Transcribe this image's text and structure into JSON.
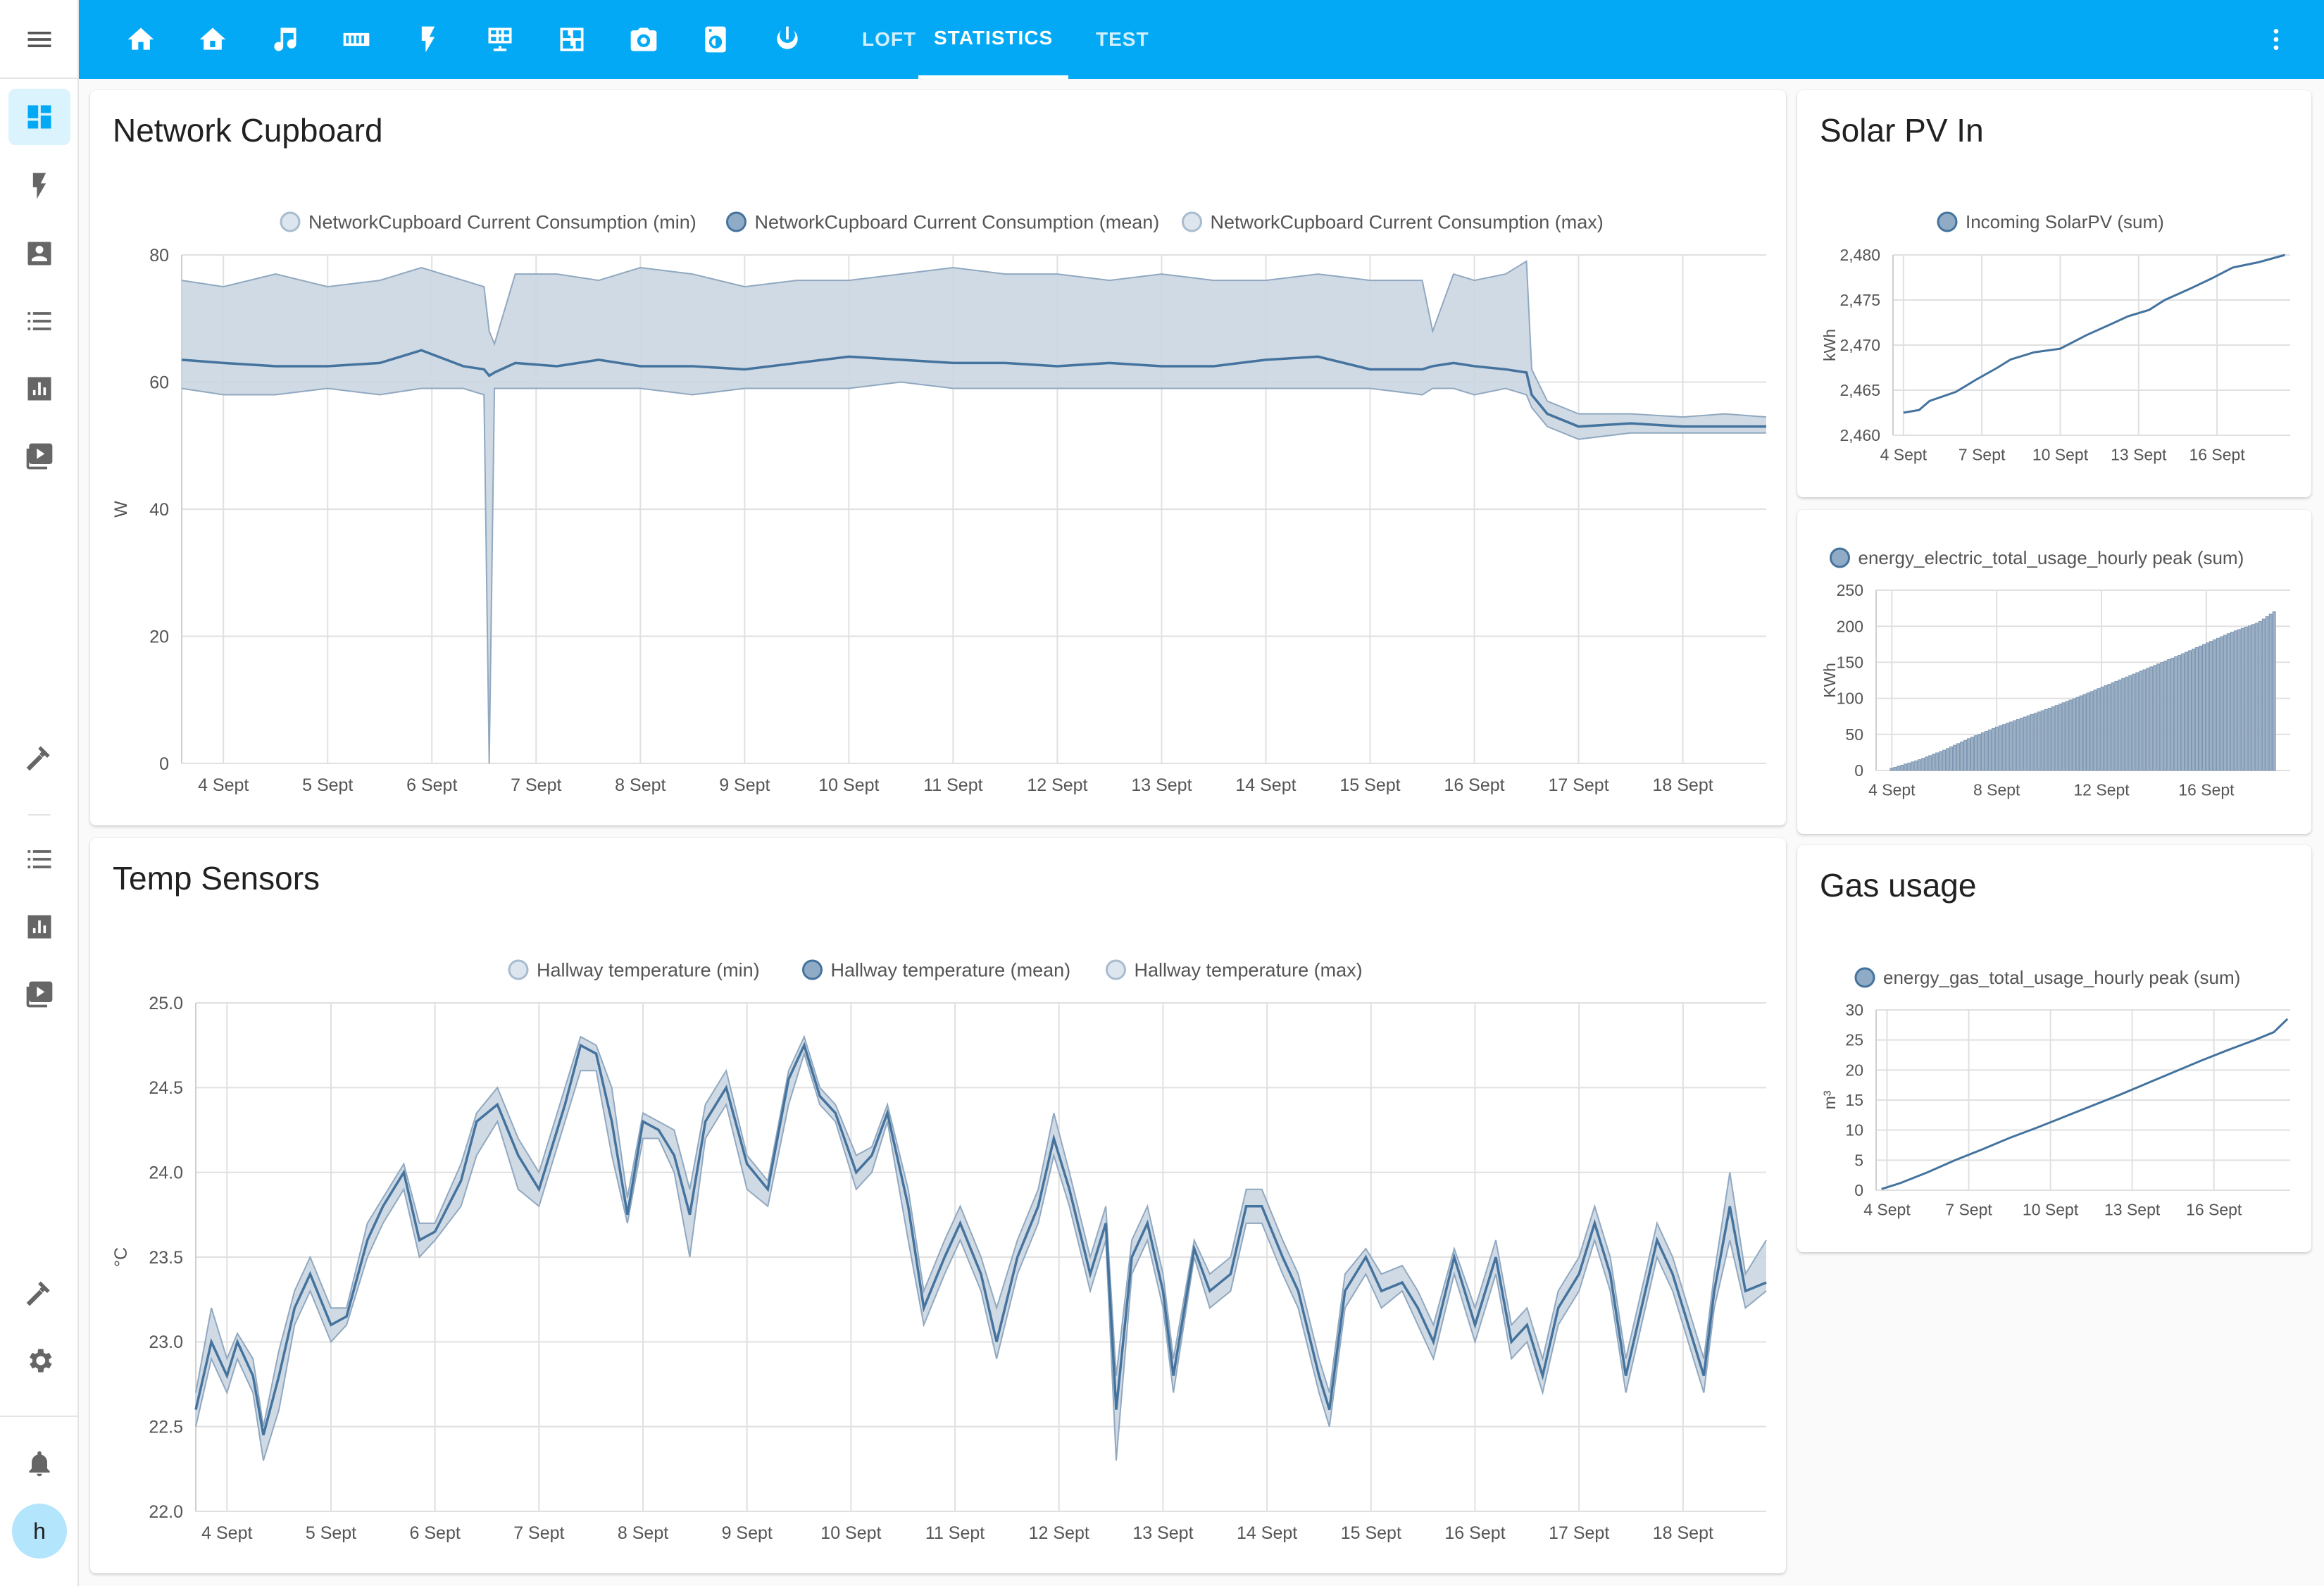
{
  "header": {
    "tabs": [
      {
        "icon": "home-icon"
      },
      {
        "icon": "home-alt-icon"
      },
      {
        "icon": "music-icon"
      },
      {
        "icon": "memory-icon"
      },
      {
        "icon": "flash-icon"
      },
      {
        "icon": "solar-panel-icon"
      },
      {
        "icon": "floor-plan-icon"
      },
      {
        "icon": "camera-icon"
      },
      {
        "icon": "washing-machine-icon"
      },
      {
        "icon": "power-icon"
      }
    ],
    "text_tabs": [
      {
        "label": "LOFT",
        "active": false
      },
      {
        "label": "STATISTICS",
        "active": true
      },
      {
        "label": "TEST",
        "active": false
      }
    ]
  },
  "sidebar": {
    "items": [
      "dashboard-icon",
      "flash-icon",
      "account-box-icon",
      "list-icon",
      "chart-icon",
      "media-icon",
      "hammer-icon",
      "list-icon",
      "chart-icon",
      "media-icon",
      "hammer-icon",
      "cog-icon",
      "bell-icon"
    ],
    "user_initial": "h"
  },
  "colors": {
    "accent": "#03a9f4",
    "series_mean": "#44739e",
    "series_band": "#cbd6e1"
  },
  "chart_data": [
    {
      "id": "network",
      "type": "area",
      "title": "Network Cupboard",
      "ylabel": "W",
      "legend": [
        "NetworkCupboard Current Consumption (min)",
        "NetworkCupboard Current Consumption (mean)",
        "NetworkCupboard Current Consumption (max)"
      ],
      "x_labels": [
        "4 Sept",
        "5 Sept",
        "6 Sept",
        "7 Sept",
        "8 Sept",
        "9 Sept",
        "10 Sept",
        "11 Sept",
        "12 Sept",
        "13 Sept",
        "14 Sept",
        "15 Sept",
        "16 Sept",
        "17 Sept",
        "18 Sept"
      ],
      "y_ticks": [
        "0",
        "20",
        "40",
        "60",
        "80"
      ],
      "ylim": [
        0,
        80
      ],
      "xlim": [
        3.6,
        18.8
      ],
      "points": [
        [
          3.6,
          59,
          63.5,
          76
        ],
        [
          4.0,
          58,
          63.0,
          75
        ],
        [
          4.5,
          58,
          62.5,
          77
        ],
        [
          5.0,
          59,
          62.5,
          75
        ],
        [
          5.5,
          58,
          63.0,
          76
        ],
        [
          5.9,
          59,
          65.0,
          78
        ],
        [
          6.3,
          59,
          62.5,
          76
        ],
        [
          6.5,
          58,
          62.0,
          75
        ],
        [
          6.55,
          0,
          61.0,
          68
        ],
        [
          6.6,
          59,
          61.5,
          66
        ],
        [
          6.8,
          59,
          63.0,
          77
        ],
        [
          7.2,
          59,
          62.5,
          77
        ],
        [
          7.6,
          59,
          63.5,
          76
        ],
        [
          8.0,
          59,
          62.5,
          78
        ],
        [
          8.5,
          58,
          62.5,
          77
        ],
        [
          9.0,
          59,
          62.0,
          75
        ],
        [
          9.5,
          59,
          63.0,
          76
        ],
        [
          10.0,
          59,
          64.0,
          76
        ],
        [
          10.5,
          60,
          63.5,
          77
        ],
        [
          11.0,
          59,
          63.0,
          78
        ],
        [
          11.5,
          59,
          63.0,
          77
        ],
        [
          12.0,
          59,
          62.5,
          77
        ],
        [
          12.5,
          59,
          63.0,
          76
        ],
        [
          13.0,
          59,
          62.5,
          77
        ],
        [
          13.5,
          59,
          62.5,
          76
        ],
        [
          14.0,
          59,
          63.5,
          76
        ],
        [
          14.5,
          59,
          64.0,
          77
        ],
        [
          15.0,
          59,
          62.0,
          76
        ],
        [
          15.5,
          58,
          62.0,
          76
        ],
        [
          15.6,
          59,
          62.5,
          68
        ],
        [
          15.8,
          59,
          63.0,
          77
        ],
        [
          16.0,
          58,
          62.5,
          76
        ],
        [
          16.3,
          59,
          62.0,
          77
        ],
        [
          16.5,
          58,
          61.5,
          79
        ],
        [
          16.55,
          56,
          58.0,
          62
        ],
        [
          16.7,
          53,
          55.0,
          57
        ],
        [
          17.0,
          51,
          53.0,
          55
        ],
        [
          17.5,
          52,
          53.5,
          55
        ],
        [
          18.0,
          52,
          53.0,
          54.5
        ],
        [
          18.4,
          52,
          53.0,
          55
        ],
        [
          18.8,
          52,
          53.0,
          54.5
        ]
      ]
    },
    {
      "id": "temp",
      "type": "area",
      "title": "Temp Sensors",
      "ylabel": "°C",
      "legend": [
        "Hallway temperature (min)",
        "Hallway temperature (mean)",
        "Hallway temperature (max)"
      ],
      "x_labels": [
        "4 Sept",
        "5 Sept",
        "6 Sept",
        "7 Sept",
        "8 Sept",
        "9 Sept",
        "10 Sept",
        "11 Sept",
        "12 Sept",
        "13 Sept",
        "14 Sept",
        "15 Sept",
        "16 Sept",
        "17 Sept",
        "18 Sept"
      ],
      "y_ticks": [
        "22.0",
        "22.5",
        "23.0",
        "23.5",
        "24.0",
        "24.5",
        "25.0"
      ],
      "ylim": [
        22,
        25
      ],
      "xlim": [
        3.7,
        18.8
      ],
      "points": [
        [
          3.7,
          22.5,
          22.6,
          22.7
        ],
        [
          3.85,
          22.9,
          23.0,
          23.2
        ],
        [
          4.0,
          22.7,
          22.8,
          22.9
        ],
        [
          4.1,
          22.9,
          23.0,
          23.05
        ],
        [
          4.25,
          22.7,
          22.8,
          22.9
        ],
        [
          4.35,
          22.3,
          22.45,
          22.5
        ],
        [
          4.5,
          22.6,
          22.8,
          22.95
        ],
        [
          4.65,
          23.1,
          23.2,
          23.3
        ],
        [
          4.8,
          23.3,
          23.4,
          23.5
        ],
        [
          5.0,
          23.0,
          23.1,
          23.2
        ],
        [
          5.15,
          23.1,
          23.15,
          23.2
        ],
        [
          5.35,
          23.5,
          23.6,
          23.7
        ],
        [
          5.5,
          23.7,
          23.8,
          23.85
        ],
        [
          5.7,
          23.9,
          24.0,
          24.05
        ],
        [
          5.85,
          23.5,
          23.6,
          23.7
        ],
        [
          6.0,
          23.6,
          23.65,
          23.7
        ],
        [
          6.25,
          23.8,
          23.95,
          24.05
        ],
        [
          6.4,
          24.1,
          24.3,
          24.35
        ],
        [
          6.6,
          24.3,
          24.4,
          24.5
        ],
        [
          6.8,
          23.9,
          24.1,
          24.2
        ],
        [
          7.0,
          23.8,
          23.9,
          24.0
        ],
        [
          7.25,
          24.3,
          24.4,
          24.5
        ],
        [
          7.4,
          24.6,
          24.75,
          24.8
        ],
        [
          7.55,
          24.6,
          24.7,
          24.75
        ],
        [
          7.7,
          24.1,
          24.3,
          24.5
        ],
        [
          7.85,
          23.7,
          23.75,
          23.85
        ],
        [
          8.0,
          24.2,
          24.3,
          24.35
        ],
        [
          8.15,
          24.2,
          24.25,
          24.3
        ],
        [
          8.3,
          24.0,
          24.1,
          24.25
        ],
        [
          8.45,
          23.5,
          23.75,
          23.9
        ],
        [
          8.6,
          24.2,
          24.3,
          24.4
        ],
        [
          8.8,
          24.4,
          24.5,
          24.6
        ],
        [
          9.0,
          23.9,
          24.05,
          24.1
        ],
        [
          9.2,
          23.8,
          23.9,
          23.95
        ],
        [
          9.4,
          24.4,
          24.55,
          24.6
        ],
        [
          9.55,
          24.7,
          24.75,
          24.8
        ],
        [
          9.7,
          24.4,
          24.45,
          24.5
        ],
        [
          9.85,
          24.3,
          24.35,
          24.4
        ],
        [
          10.05,
          23.9,
          24.0,
          24.1
        ],
        [
          10.2,
          24.0,
          24.1,
          24.15
        ],
        [
          10.35,
          24.3,
          24.35,
          24.4
        ],
        [
          10.55,
          23.6,
          23.8,
          23.9
        ],
        [
          10.7,
          23.1,
          23.2,
          23.3
        ],
        [
          10.9,
          23.4,
          23.5,
          23.6
        ],
        [
          11.05,
          23.6,
          23.7,
          23.8
        ],
        [
          11.25,
          23.3,
          23.4,
          23.5
        ],
        [
          11.4,
          22.9,
          23.0,
          23.2
        ],
        [
          11.6,
          23.4,
          23.5,
          23.6
        ],
        [
          11.8,
          23.7,
          23.8,
          23.9
        ],
        [
          11.95,
          24.1,
          24.2,
          24.35
        ],
        [
          12.1,
          23.8,
          23.9,
          24.0
        ],
        [
          12.3,
          23.3,
          23.4,
          23.5
        ],
        [
          12.45,
          23.6,
          23.7,
          23.8
        ],
        [
          12.55,
          22.3,
          22.6,
          22.8
        ],
        [
          12.7,
          23.4,
          23.5,
          23.6
        ],
        [
          12.85,
          23.6,
          23.7,
          23.8
        ],
        [
          13.0,
          23.2,
          23.3,
          23.4
        ],
        [
          13.1,
          22.7,
          22.8,
          22.9
        ],
        [
          13.3,
          23.5,
          23.55,
          23.6
        ],
        [
          13.45,
          23.2,
          23.3,
          23.4
        ],
        [
          13.65,
          23.3,
          23.4,
          23.5
        ],
        [
          13.8,
          23.7,
          23.8,
          23.9
        ],
        [
          13.95,
          23.7,
          23.8,
          23.9
        ],
        [
          14.15,
          23.4,
          23.5,
          23.6
        ],
        [
          14.3,
          23.2,
          23.3,
          23.4
        ],
        [
          14.5,
          22.7,
          22.8,
          22.9
        ],
        [
          14.6,
          22.5,
          22.6,
          22.7
        ],
        [
          14.75,
          23.2,
          23.3,
          23.4
        ],
        [
          14.95,
          23.4,
          23.5,
          23.55
        ],
        [
          15.1,
          23.2,
          23.3,
          23.4
        ],
        [
          15.3,
          23.3,
          23.35,
          23.45
        ],
        [
          15.45,
          23.1,
          23.2,
          23.3
        ],
        [
          15.6,
          22.9,
          23.0,
          23.1
        ],
        [
          15.8,
          23.4,
          23.5,
          23.55
        ],
        [
          16.0,
          23.0,
          23.1,
          23.2
        ],
        [
          16.2,
          23.4,
          23.5,
          23.6
        ],
        [
          16.35,
          22.9,
          23.0,
          23.1
        ],
        [
          16.5,
          23.0,
          23.1,
          23.2
        ],
        [
          16.65,
          22.7,
          22.8,
          22.9
        ],
        [
          16.8,
          23.1,
          23.2,
          23.3
        ],
        [
          17.0,
          23.3,
          23.4,
          23.5
        ],
        [
          17.15,
          23.6,
          23.7,
          23.8
        ],
        [
          17.3,
          23.3,
          23.4,
          23.5
        ],
        [
          17.45,
          22.7,
          22.8,
          22.9
        ],
        [
          17.6,
          23.1,
          23.2,
          23.3
        ],
        [
          17.75,
          23.5,
          23.6,
          23.7
        ],
        [
          17.9,
          23.3,
          23.4,
          23.5
        ],
        [
          18.05,
          23.0,
          23.1,
          23.2
        ],
        [
          18.2,
          22.7,
          22.8,
          22.9
        ],
        [
          18.3,
          23.2,
          23.3,
          23.4
        ],
        [
          18.45,
          23.6,
          23.8,
          24.0
        ],
        [
          18.6,
          23.2,
          23.3,
          23.4
        ],
        [
          18.8,
          23.3,
          23.35,
          23.6
        ]
      ]
    },
    {
      "id": "solar",
      "type": "line",
      "title": "Solar PV In",
      "ylabel": "kWh",
      "legend": [
        "Incoming SolarPV (sum)"
      ],
      "x_labels": [
        "4 Sept",
        "7 Sept",
        "10 Sept",
        "13 Sept",
        "16 Sept"
      ],
      "y_ticks": [
        "2,460",
        "2,465",
        "2,470",
        "2,475",
        "2,480"
      ],
      "ylim": [
        2460,
        2480
      ],
      "xlim": [
        3.6,
        18.8
      ],
      "points": [
        [
          4.0,
          2462.5
        ],
        [
          4.6,
          2462.8
        ],
        [
          5.0,
          2463.8
        ],
        [
          6.0,
          2464.8
        ],
        [
          6.8,
          2466.2
        ],
        [
          7.6,
          2467.5
        ],
        [
          8.1,
          2468.4
        ],
        [
          9.0,
          2469.2
        ],
        [
          10.0,
          2469.6
        ],
        [
          11.0,
          2471.1
        ],
        [
          12.0,
          2472.4
        ],
        [
          12.6,
          2473.2
        ],
        [
          13.4,
          2473.9
        ],
        [
          14.0,
          2475.0
        ],
        [
          15.0,
          2476.3
        ],
        [
          15.8,
          2477.4
        ],
        [
          16.6,
          2478.6
        ],
        [
          17.6,
          2479.2
        ],
        [
          18.6,
          2480.0
        ]
      ]
    },
    {
      "id": "electric",
      "type": "bar",
      "title": "",
      "ylabel": "KWh",
      "legend": [
        "energy_electric_total_usage_hourly peak (sum)"
      ],
      "x_labels": [
        "4 Sept",
        "8 Sept",
        "12 Sept",
        "16 Sept"
      ],
      "y_ticks": [
        "0",
        "50",
        "100",
        "150",
        "200",
        "250"
      ],
      "ylim": [
        0,
        250
      ],
      "xlim": [
        3.4,
        19.2
      ],
      "bar_range": [
        4.0,
        18.6
      ],
      "bar_values": [
        [
          4.0,
          3
        ],
        [
          5.0,
          14
        ],
        [
          6.0,
          28
        ],
        [
          7.0,
          45
        ],
        [
          8.0,
          60
        ],
        [
          9.0,
          73
        ],
        [
          10.0,
          86
        ],
        [
          11.0,
          100
        ],
        [
          12.0,
          115
        ],
        [
          13.0,
          130
        ],
        [
          14.0,
          145
        ],
        [
          15.0,
          160
        ],
        [
          16.0,
          176
        ],
        [
          17.0,
          192
        ],
        [
          18.0,
          205
        ],
        [
          18.6,
          220
        ]
      ]
    },
    {
      "id": "gas",
      "type": "line",
      "title": "Gas usage",
      "ylabel": "m³",
      "legend": [
        "energy_gas_total_usage_hourly peak (sum)"
      ],
      "x_labels": [
        "4 Sept",
        "7 Sept",
        "10 Sept",
        "13 Sept",
        "16 Sept"
      ],
      "y_ticks": [
        "0",
        "5",
        "10",
        "15",
        "20",
        "25",
        "30"
      ],
      "ylim": [
        0,
        30
      ],
      "xlim": [
        3.6,
        18.8
      ],
      "points": [
        [
          3.8,
          0.2
        ],
        [
          4.5,
          1.2
        ],
        [
          5.5,
          3.0
        ],
        [
          6.5,
          5.0
        ],
        [
          7.5,
          6.8
        ],
        [
          8.5,
          8.7
        ],
        [
          9.5,
          10.4
        ],
        [
          10.5,
          12.2
        ],
        [
          11.5,
          14.0
        ],
        [
          12.5,
          15.8
        ],
        [
          13.5,
          17.7
        ],
        [
          14.5,
          19.6
        ],
        [
          15.5,
          21.5
        ],
        [
          16.5,
          23.3
        ],
        [
          17.5,
          25.0
        ],
        [
          18.2,
          26.3
        ],
        [
          18.7,
          28.5
        ]
      ]
    }
  ]
}
